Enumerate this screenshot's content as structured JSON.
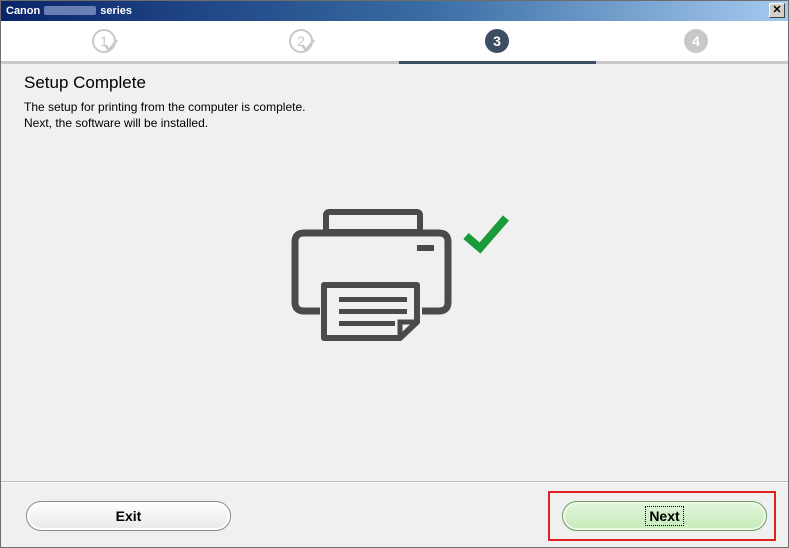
{
  "window": {
    "title_prefix": "Canon",
    "title_suffix": "series"
  },
  "steps": [
    {
      "label": "1",
      "state": "done"
    },
    {
      "label": "2",
      "state": "done"
    },
    {
      "label": "3",
      "state": "current"
    },
    {
      "label": "4",
      "state": "pending"
    }
  ],
  "content": {
    "heading": "Setup Complete",
    "line1": "The setup for printing from the computer is complete.",
    "line2": "Next, the software will be installed."
  },
  "illustration": {
    "icon": "printer-icon",
    "status_icon": "checkmark-icon",
    "check_color": "#1a9b3a",
    "printer_color": "#4a4a4a"
  },
  "buttons": {
    "exit_label": "Exit",
    "next_label": "Next"
  },
  "colors": {
    "step_active": "#3d4d63",
    "step_inactive": "#c8c8c8",
    "next_button": "#c5eab8",
    "highlight_border": "#e32020"
  }
}
